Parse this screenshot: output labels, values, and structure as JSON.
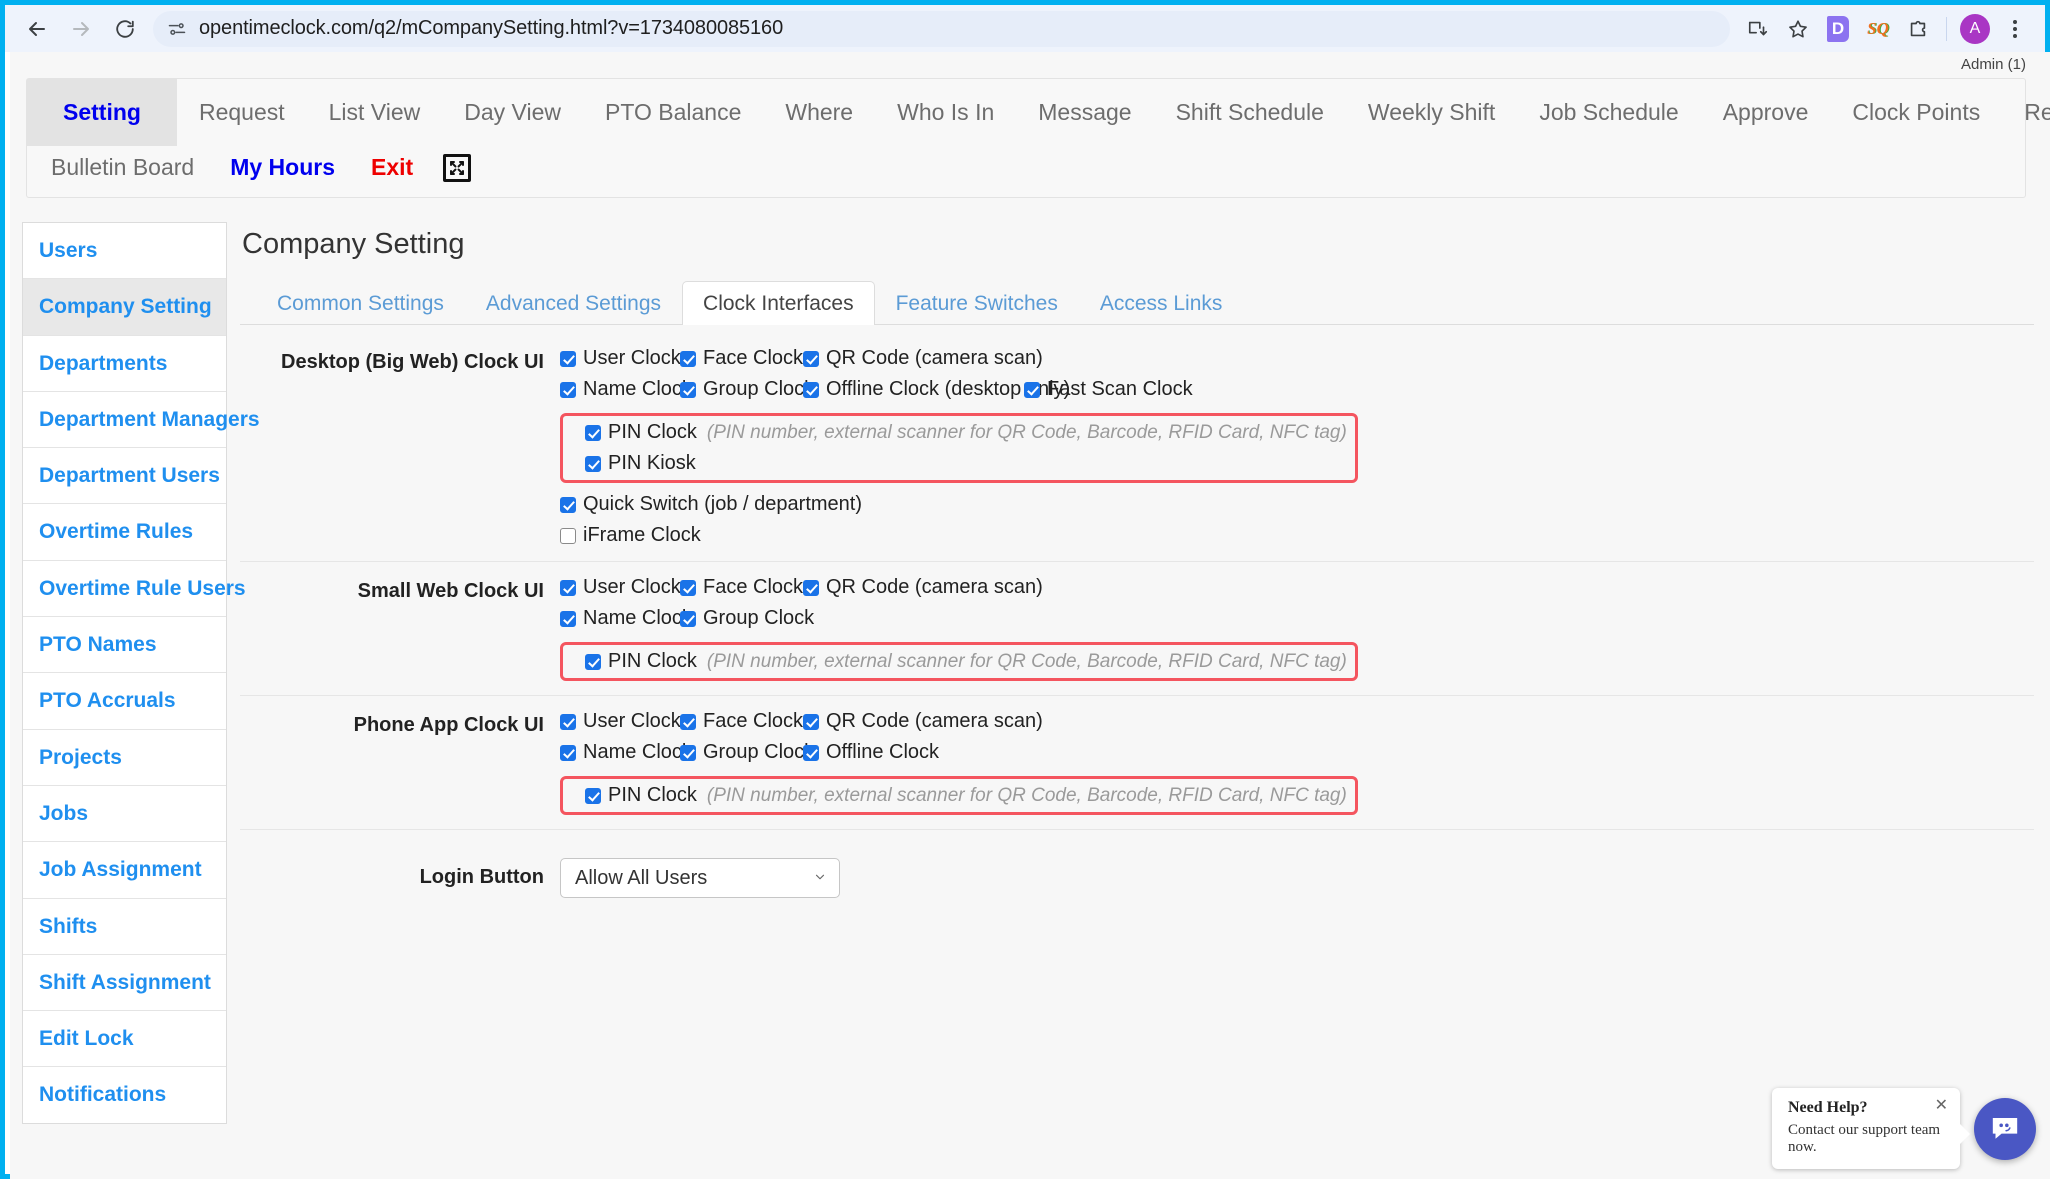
{
  "browser": {
    "url": "opentimeclock.com/q2/mCompanySetting.html?v=1734080085160",
    "back_label": "Back",
    "forward_label": "Forward",
    "reload_label": "Reload",
    "install_label": "Install",
    "bookmark_label": "Bookmark",
    "extension_d_label": "D",
    "extension_sq_label": "SQ",
    "extensions_label": "Extensions",
    "profile_label": "A",
    "menu_label": "Customize and control"
  },
  "header": {
    "admin_label": "Admin (1)"
  },
  "topnav": {
    "row1": [
      {
        "label": "Setting",
        "active": true
      },
      {
        "label": "Request",
        "active": false
      },
      {
        "label": "List View",
        "active": false
      },
      {
        "label": "Day View",
        "active": false
      },
      {
        "label": "PTO Balance",
        "active": false
      },
      {
        "label": "Where",
        "active": false
      },
      {
        "label": "Who Is In",
        "active": false
      },
      {
        "label": "Message",
        "active": false
      },
      {
        "label": "Shift Schedule",
        "active": false
      },
      {
        "label": "Weekly Shift",
        "active": false
      },
      {
        "label": "Job Schedule",
        "active": false
      },
      {
        "label": "Approve",
        "active": false
      },
      {
        "label": "Clock Points",
        "active": false
      },
      {
        "label": "Reports",
        "active": false
      }
    ],
    "row2": [
      {
        "label": "Bulletin Board",
        "style": "gray"
      },
      {
        "label": "My Hours",
        "style": "blue"
      },
      {
        "label": "Exit",
        "style": "red"
      }
    ],
    "expand_icon": "expand-fullscreen-icon"
  },
  "sidebar": {
    "items": [
      {
        "label": "Users",
        "active": false
      },
      {
        "label": "Company Setting",
        "active": true
      },
      {
        "label": "Departments",
        "active": false
      },
      {
        "label": "Department Managers",
        "active": false
      },
      {
        "label": "Department Users",
        "active": false
      },
      {
        "label": "Overtime Rules",
        "active": false
      },
      {
        "label": "Overtime Rule Users",
        "active": false
      },
      {
        "label": "PTO Names",
        "active": false
      },
      {
        "label": "PTO Accruals",
        "active": false
      },
      {
        "label": "Projects",
        "active": false
      },
      {
        "label": "Jobs",
        "active": false
      },
      {
        "label": "Job Assignment",
        "active": false
      },
      {
        "label": "Shifts",
        "active": false
      },
      {
        "label": "Shift Assignment",
        "active": false
      },
      {
        "label": "Edit Lock",
        "active": false
      },
      {
        "label": "Notifications",
        "active": false
      }
    ]
  },
  "main": {
    "title": "Company Setting",
    "tabs": [
      {
        "label": "Common Settings",
        "active": false
      },
      {
        "label": "Advanced Settings",
        "active": false
      },
      {
        "label": "Clock Interfaces",
        "active": true
      },
      {
        "label": "Feature Switches",
        "active": false
      },
      {
        "label": "Access Links",
        "active": false
      }
    ],
    "pin_hint": "(PIN number, external scanner for QR Code, Barcode, RFID Card, NFC tag)",
    "desktop": {
      "label": "Desktop (Big Web) Clock UI",
      "r1c1": {
        "label": "User Clock",
        "checked": true
      },
      "r1c2": {
        "label": "Face Clock",
        "checked": true
      },
      "r1c3": {
        "label": "QR Code (camera scan)",
        "checked": true
      },
      "r2c1": {
        "label": "Name Clock",
        "checked": true
      },
      "r2c2": {
        "label": "Group Clock",
        "checked": true
      },
      "r2c3": {
        "label": "Offline Clock (desktop only)",
        "checked": true
      },
      "r2c4": {
        "label": "Fast Scan Clock",
        "checked": true
      },
      "pin_clock": {
        "label": "PIN Clock",
        "checked": true
      },
      "pin_kiosk": {
        "label": "PIN Kiosk",
        "checked": true
      },
      "quick_switch": {
        "label": "Quick Switch (job / department)",
        "checked": true
      },
      "iframe_clock": {
        "label": "iFrame Clock",
        "checked": false
      }
    },
    "small_web": {
      "label": "Small Web Clock UI",
      "r1c1": {
        "label": "User Clock",
        "checked": true
      },
      "r1c2": {
        "label": "Face Clock",
        "checked": true
      },
      "r1c3": {
        "label": "QR Code (camera scan)",
        "checked": true
      },
      "r2c1": {
        "label": "Name Clock",
        "checked": true
      },
      "r2c2": {
        "label": "Group Clock",
        "checked": true
      },
      "pin_clock": {
        "label": "PIN Clock",
        "checked": true
      }
    },
    "phone_app": {
      "label": "Phone App Clock UI",
      "r1c1": {
        "label": "User Clock",
        "checked": true
      },
      "r1c2": {
        "label": "Face Clock",
        "checked": true
      },
      "r1c3": {
        "label": "QR Code (camera scan)",
        "checked": true
      },
      "r2c1": {
        "label": "Name Clock",
        "checked": true
      },
      "r2c2": {
        "label": "Group Clock",
        "checked": true
      },
      "r2c3": {
        "label": "Offline Clock",
        "checked": true
      },
      "pin_clock": {
        "label": "PIN Clock",
        "checked": true
      }
    },
    "login_button": {
      "label": "Login Button",
      "value": "Allow All Users",
      "caret_icon": "chevron-down-icon"
    }
  },
  "chat": {
    "title": "Need Help?",
    "subtitle": "Contact our support team now.",
    "close_label": "✕",
    "fab_icon": "chat-bubble-icon"
  },
  "colors": {
    "accent_blue": "#1f8fef",
    "checkbox_blue": "#1a73e8",
    "highlight_red": "#f4555f",
    "frame_cyan": "#00b0f0",
    "link_blue": "#0000ee",
    "exit_red": "#ee0000"
  }
}
